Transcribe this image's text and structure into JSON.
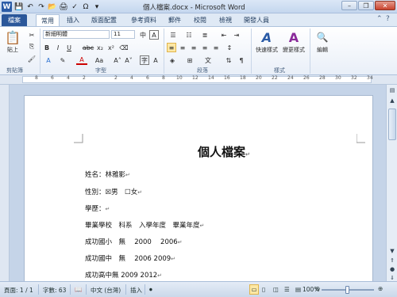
{
  "window": {
    "title": "個人檔案.docx - Microsoft Word",
    "app_logo": "W"
  },
  "tabs": {
    "file": "檔案",
    "items": [
      "常用",
      "插入",
      "版面配置",
      "參考資料",
      "郵件",
      "校閱",
      "檢視",
      "開發人員"
    ]
  },
  "ribbon": {
    "clipboard": {
      "paste": "貼上",
      "label": "剪貼簿"
    },
    "font": {
      "name": "新細明體",
      "size": "11",
      "label": "字型"
    },
    "paragraph": {
      "label": "段落"
    },
    "styles": {
      "quick": "快速樣式",
      "change": "變更樣式",
      "label": "樣式"
    },
    "editing": {
      "label": "編輯"
    }
  },
  "document": {
    "title": "個人檔案",
    "lines": [
      "姓名：林雅影",
      "性別：☒男　☐女",
      "學歷：",
      "畢業學校　科系　入學年度　畢業年度",
      "成功國小　無　 2000　 2006",
      "成功國中　無　 2006 2009",
      "成功高中無 2009 2012"
    ]
  },
  "status": {
    "page": "頁面: 1 / 1",
    "words": "字數: 63",
    "language": "中文 (台灣)",
    "mode": "插入",
    "zoom": "100%",
    "zoom_level": 100
  }
}
